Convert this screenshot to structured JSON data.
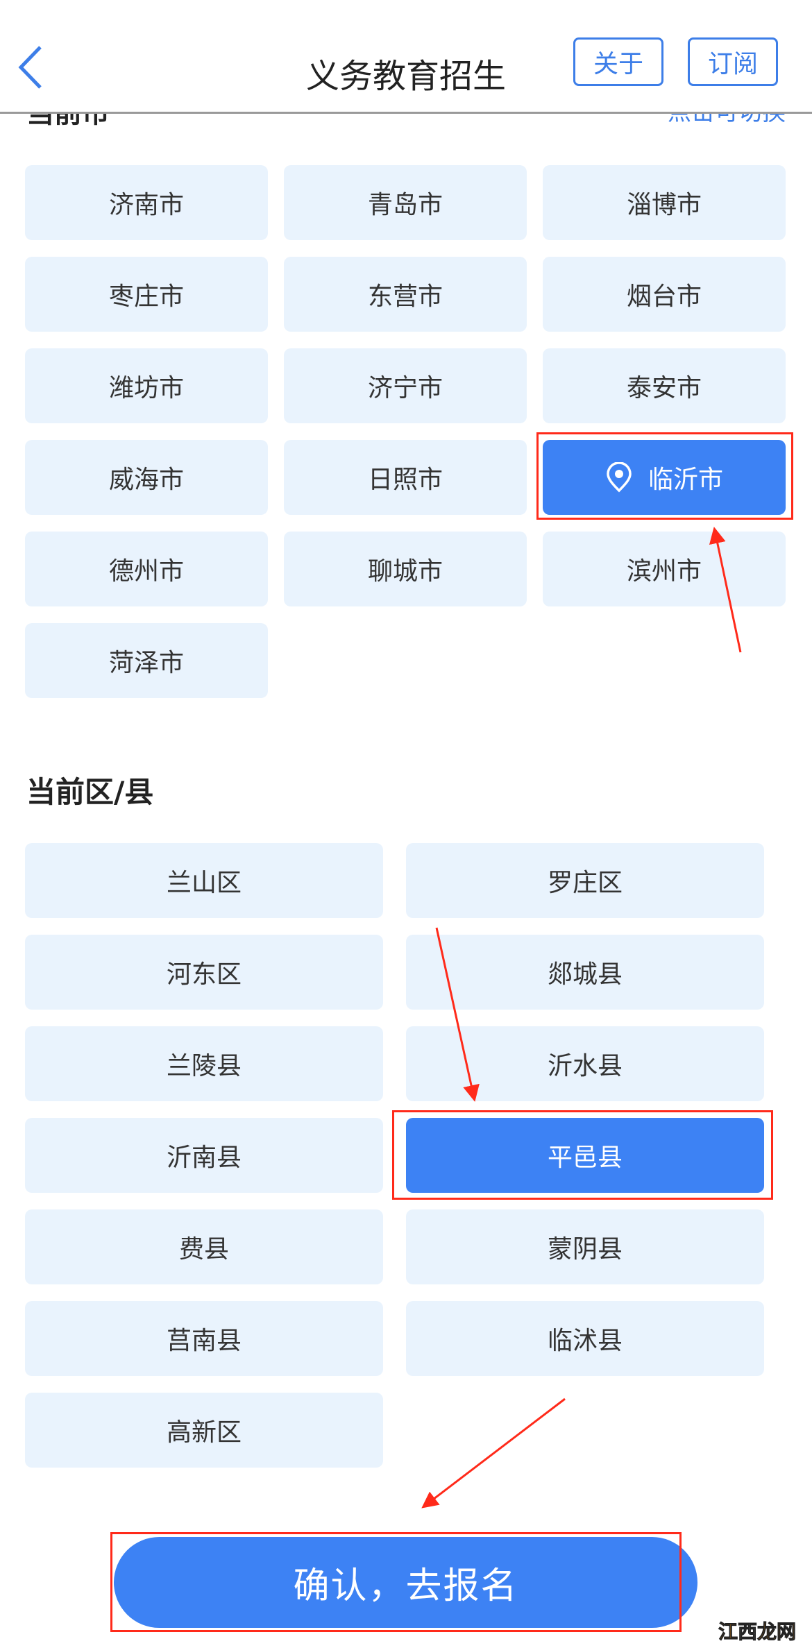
{
  "header": {
    "title": "义务教育招生",
    "about_label": "关于",
    "subscribe_label": "订阅",
    "back_icon": "chevron-left-icon"
  },
  "city_section": {
    "heading": "当前市",
    "switch_hint": "点击可切换",
    "selected": "临沂市",
    "items": [
      "济南市",
      "青岛市",
      "淄博市",
      "枣庄市",
      "东营市",
      "烟台市",
      "潍坊市",
      "济宁市",
      "泰安市",
      "威海市",
      "日照市",
      "临沂市",
      "德州市",
      "聊城市",
      "滨州市",
      "菏泽市"
    ]
  },
  "district_section": {
    "heading": "当前区/县",
    "selected": "平邑县",
    "items": [
      "兰山区",
      "罗庄区",
      "河东区",
      "郯城县",
      "兰陵县",
      "沂水县",
      "沂南县",
      "平邑县",
      "费县",
      "蒙阴县",
      "莒南县",
      "临沭县",
      "高新区"
    ]
  },
  "confirm_label": "确认，去报名",
  "watermark": "江西龙网",
  "colors": {
    "accent": "#3d82f4",
    "option_bg": "#e9f3fd",
    "annotation": "#ff2a1a"
  }
}
